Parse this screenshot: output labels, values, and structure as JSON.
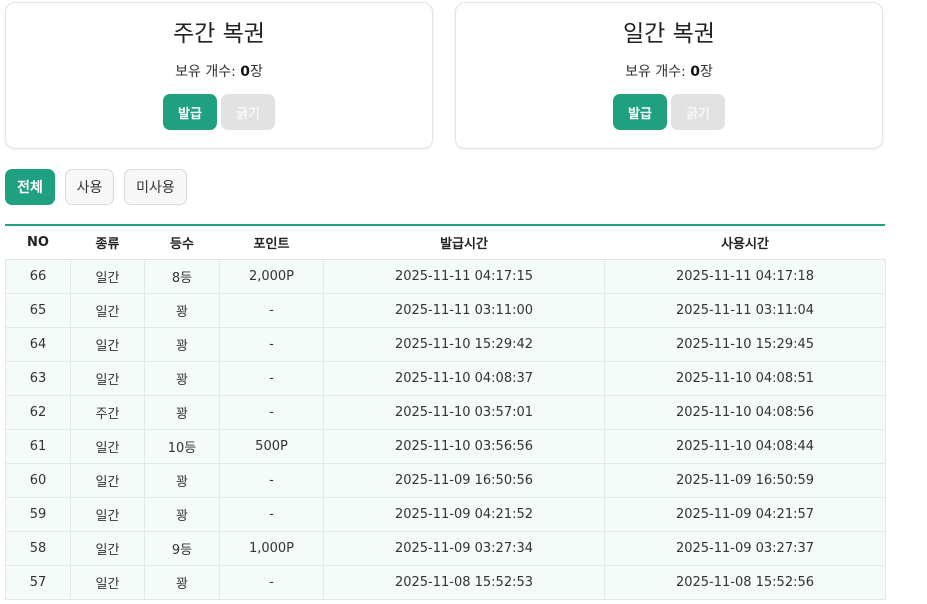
{
  "cards": {
    "weekly": {
      "title": "주간 복권",
      "count_label": "보유 개수: ",
      "count_value": "0",
      "count_unit": "장",
      "issue_label": "발급",
      "scratch_label": "긁기"
    },
    "daily": {
      "title": "일간 복권",
      "count_label": "보유 개수: ",
      "count_value": "0",
      "count_unit": "장",
      "issue_label": "발급",
      "scratch_label": "긁기"
    }
  },
  "filters": {
    "all": "전체",
    "used": "사용",
    "unused": "미사용",
    "selected": "전체"
  },
  "table": {
    "headers": {
      "no": "NO",
      "type": "종류",
      "rank": "등수",
      "points": "포인트",
      "issued": "발급시간",
      "used": "사용시간"
    },
    "rows": [
      {
        "no": "66",
        "type": "일간",
        "rank": "8등",
        "points": "2,000P",
        "issued": "2025-11-11 04:17:15",
        "used": "2025-11-11 04:17:18"
      },
      {
        "no": "65",
        "type": "일간",
        "rank": "꽝",
        "points": "-",
        "issued": "2025-11-11 03:11:00",
        "used": "2025-11-11 03:11:04"
      },
      {
        "no": "64",
        "type": "일간",
        "rank": "꽝",
        "points": "-",
        "issued": "2025-11-10 15:29:42",
        "used": "2025-11-10 15:29:45"
      },
      {
        "no": "63",
        "type": "일간",
        "rank": "꽝",
        "points": "-",
        "issued": "2025-11-10 04:08:37",
        "used": "2025-11-10 04:08:51"
      },
      {
        "no": "62",
        "type": "주간",
        "rank": "꽝",
        "points": "-",
        "issued": "2025-11-10 03:57:01",
        "used": "2025-11-10 04:08:56"
      },
      {
        "no": "61",
        "type": "일간",
        "rank": "10등",
        "points": "500P",
        "issued": "2025-11-10 03:56:56",
        "used": "2025-11-10 04:08:44"
      },
      {
        "no": "60",
        "type": "일간",
        "rank": "꽝",
        "points": "-",
        "issued": "2025-11-09 16:50:56",
        "used": "2025-11-09 16:50:59"
      },
      {
        "no": "59",
        "type": "일간",
        "rank": "꽝",
        "points": "-",
        "issued": "2025-11-09 04:21:52",
        "used": "2025-11-09 04:21:57"
      },
      {
        "no": "58",
        "type": "일간",
        "rank": "9등",
        "points": "1,000P",
        "issued": "2025-11-09 03:27:34",
        "used": "2025-11-09 03:27:37"
      },
      {
        "no": "57",
        "type": "일간",
        "rank": "꽝",
        "points": "-",
        "issued": "2025-11-08 15:52:53",
        "used": "2025-11-08 15:52:56"
      }
    ]
  },
  "colors": {
    "accent": "#1fa080",
    "row_bg": "#f5fbf8",
    "disabled_btn": "#e2e2e2"
  }
}
